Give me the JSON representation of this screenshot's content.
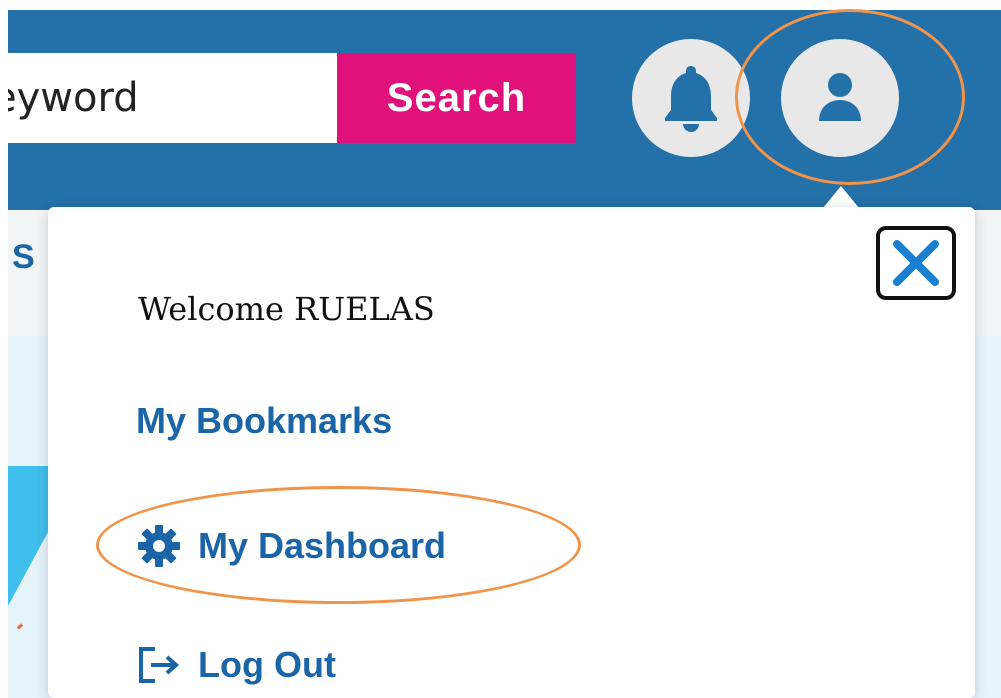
{
  "header": {
    "search_input_value": "eyword",
    "search_button_label": "Search"
  },
  "nav": {
    "partial_tab_label": "S"
  },
  "user_menu": {
    "welcome_text": "Welcome  RUELAS",
    "items": [
      {
        "label": "My Bookmarks",
        "icon": null
      },
      {
        "label": "My Dashboard",
        "icon": "gear-icon"
      },
      {
        "label": "Log Out",
        "icon": "logout-icon"
      }
    ]
  },
  "colors": {
    "header_bg": "#2470a9",
    "search_button_bg": "#e0117a",
    "link": "#1a64a8",
    "annotation": "#f0944a"
  }
}
